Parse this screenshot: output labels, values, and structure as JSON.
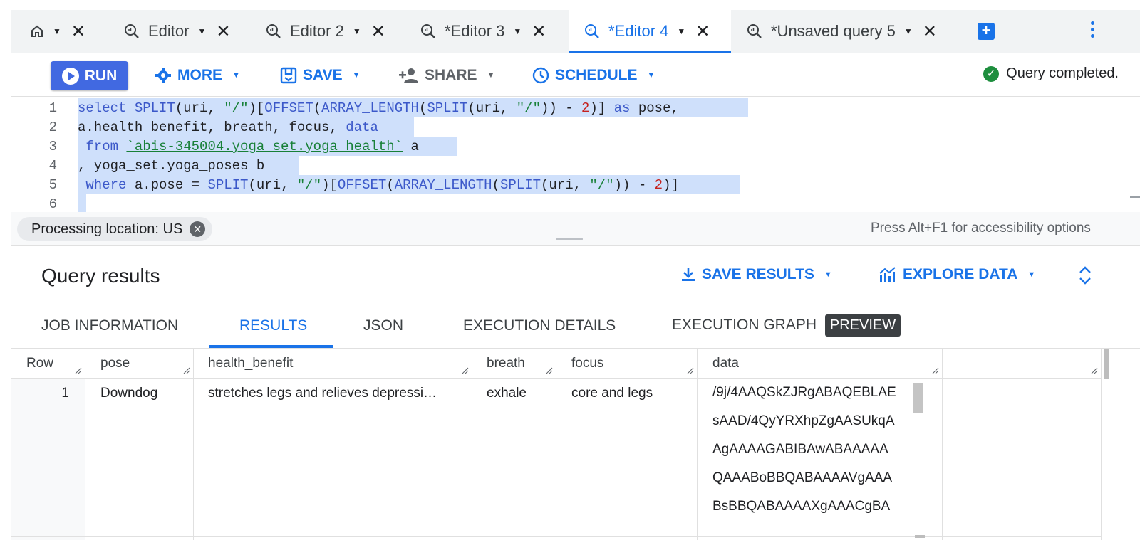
{
  "tabs": [
    {
      "label": "",
      "icon": "home-icon"
    },
    {
      "label": "Editor",
      "icon": "query-icon"
    },
    {
      "label": "Editor 2",
      "icon": "query-icon"
    },
    {
      "label": "*Editor 3",
      "icon": "query-icon"
    },
    {
      "label": "*Editor 4",
      "icon": "query-icon",
      "active": true
    },
    {
      "label": "*Unsaved query 5",
      "icon": "query-icon"
    }
  ],
  "toolbar": {
    "run": "RUN",
    "more": "MORE",
    "save": "SAVE",
    "share": "SHARE",
    "schedule": "SCHEDULE",
    "status": "Query completed."
  },
  "editor": {
    "line_numbers": [
      "1",
      "2",
      "3",
      "4",
      "5",
      "6"
    ],
    "lines": [
      "select SPLIT(uri, \"/\")[OFFSET(ARRAY_LENGTH(SPLIT(uri, \"/\")) - 2)] as pose,",
      "a.health_benefit, breath, focus, data",
      " from `abis-345004.yoga_set.yoga_health` a",
      ", yoga_set.yoga_poses b",
      " where a.pose = SPLIT(uri, \"/\")[OFFSET(ARRAY_LENGTH(SPLIT(uri, \"/\")) - 2)]",
      ""
    ]
  },
  "processing": {
    "location": "Processing location: US",
    "accessibility": "Press Alt+F1 for accessibility options"
  },
  "results": {
    "title": "Query results",
    "save_results": "SAVE RESULTS",
    "explore_data": "EXPLORE DATA",
    "tabs": [
      "JOB INFORMATION",
      "RESULTS",
      "JSON",
      "EXECUTION DETAILS",
      "EXECUTION GRAPH"
    ],
    "active_tab": "RESULTS",
    "preview_badge": "PREVIEW"
  },
  "table": {
    "columns": [
      "Row",
      "pose",
      "health_benefit",
      "breath",
      "focus",
      "data"
    ],
    "rows": [
      {
        "row": "1",
        "pose": "Downdog",
        "health_benefit": "stretches legs and relieves depressi…",
        "breath": "exhale",
        "focus": "core and legs",
        "data": [
          "/9j/4AAQSkZJRgABAQEBLAE",
          "sAAD/4QyYRXhpZgAASUkqA",
          "AgAAAAGABIBAwABAAAAA",
          "QAAABoBBQABAAAAVgAAA",
          "BsBBQABAAAAXgAAACgBA"
        ]
      }
    ]
  },
  "colors": {
    "accent": "#1a73e8",
    "run_button": "#4169e1",
    "success": "#1e8e3e",
    "selection": "#cfe0fb"
  }
}
